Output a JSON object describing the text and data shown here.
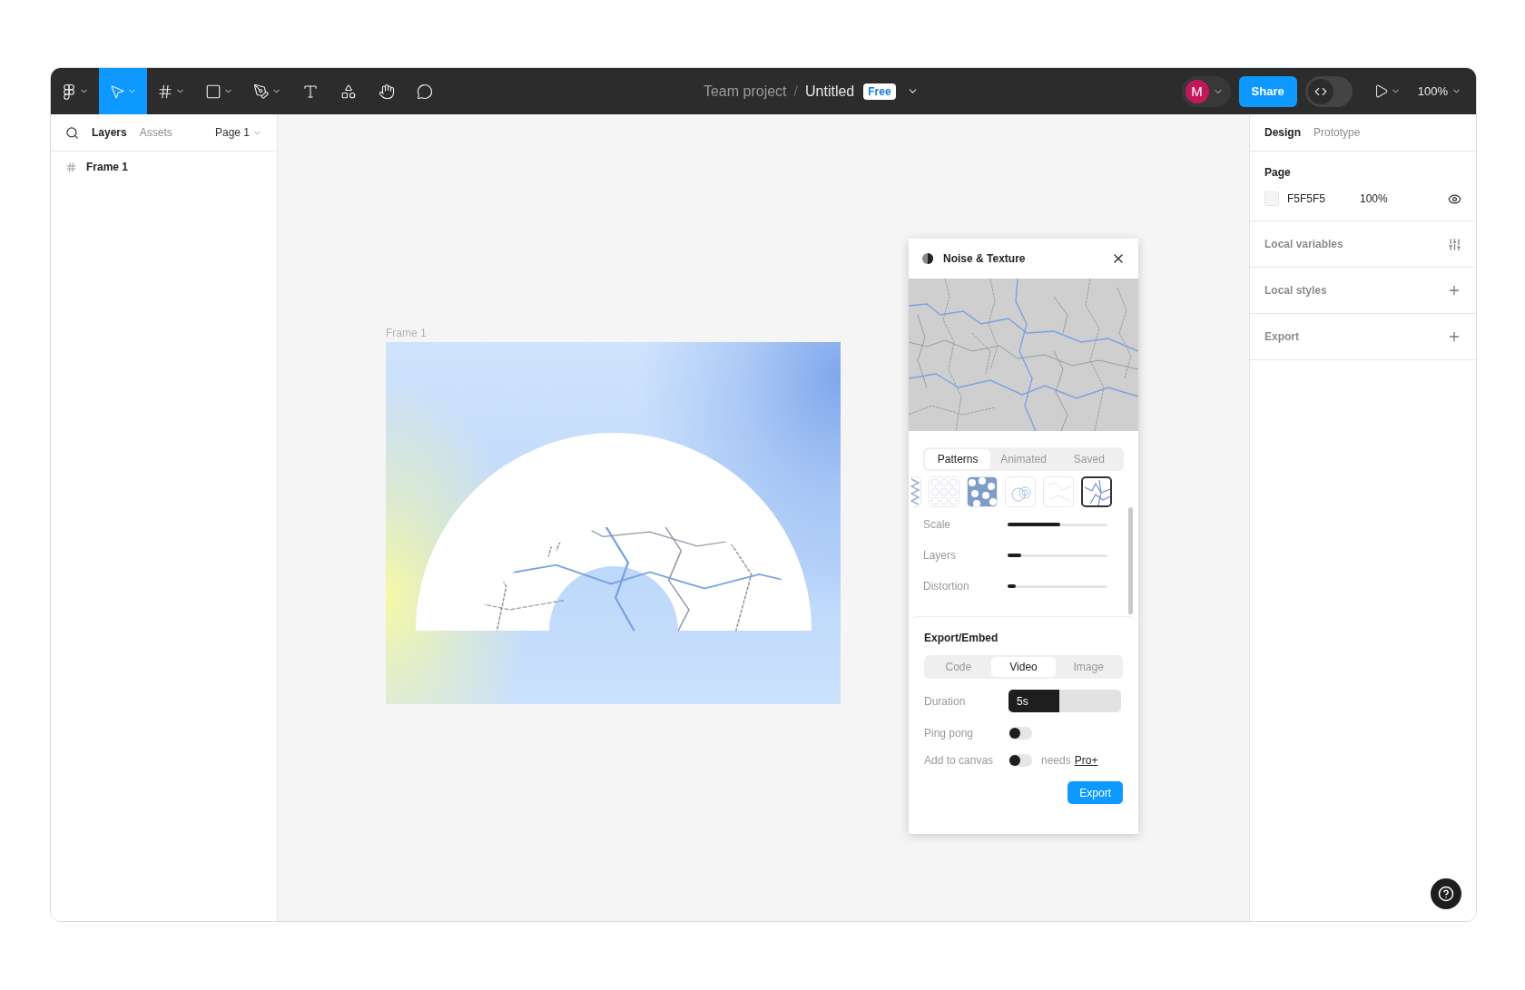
{
  "toolbar": {
    "tools": [
      {
        "kind": "menu",
        "selected": false,
        "caret": true
      },
      {
        "kind": "move",
        "selected": true,
        "caret": true
      },
      {
        "kind": "frame",
        "selected": false,
        "caret": true
      },
      {
        "kind": "shape",
        "selected": false,
        "caret": true
      },
      {
        "kind": "pen",
        "selected": false,
        "caret": true
      },
      {
        "kind": "text",
        "selected": false,
        "caret": false
      },
      {
        "kind": "components",
        "selected": false,
        "caret": false
      },
      {
        "kind": "hand",
        "selected": false,
        "caret": false
      },
      {
        "kind": "comment",
        "selected": false,
        "caret": false
      }
    ],
    "project": "Team project",
    "separator": "/",
    "file": "Untitled",
    "plan_badge": "Free",
    "avatar": "M",
    "share": "Share",
    "dev_mode": {
      "on": false
    },
    "zoom": "100%"
  },
  "left_panel": {
    "tabs": [
      {
        "label": "Layers",
        "selected": true
      },
      {
        "label": "Assets",
        "selected": false
      }
    ],
    "page": "Page 1",
    "layers": [
      {
        "name": "Frame 1"
      }
    ]
  },
  "canvas": {
    "frame_label": "Frame 1"
  },
  "plugin": {
    "title": "Noise & Texture",
    "tabs": [
      {
        "label": "Patterns",
        "selected": true
      },
      {
        "label": "Animated",
        "selected": false
      },
      {
        "label": "Saved",
        "selected": false
      }
    ],
    "patterns": [
      {
        "kind": "zigzag",
        "selected": false
      },
      {
        "kind": "cells",
        "selected": false
      },
      {
        "kind": "blobs",
        "selected": false
      },
      {
        "kind": "rings",
        "selected": false
      },
      {
        "kind": "faint",
        "selected": false
      },
      {
        "kind": "cracks",
        "selected": true
      }
    ],
    "sliders": [
      {
        "label": "Scale",
        "level": 0.53
      },
      {
        "label": "Layers",
        "level": 0.14
      },
      {
        "label": "Distortion",
        "level": 0.08
      }
    ],
    "export_title": "Export/Embed",
    "export_tabs": [
      {
        "label": "Code",
        "selected": false
      },
      {
        "label": "Video",
        "selected": true
      },
      {
        "label": "Image",
        "selected": false
      }
    ],
    "duration": {
      "label": "Duration",
      "value": "5s",
      "level": 0.45
    },
    "toggles": [
      {
        "label": "Ping pong",
        "on": false
      },
      {
        "label": "Add to canvas",
        "on": false,
        "note": "needs",
        "link": "Pro+"
      }
    ],
    "button": "Export"
  },
  "right_panel": {
    "tabs": [
      {
        "label": "Design",
        "selected": true
      },
      {
        "label": "Prototype",
        "selected": false
      }
    ],
    "page": {
      "title": "Page",
      "color": "F5F5F5",
      "opacity": "100%"
    },
    "sections": [
      {
        "title": "Local variables",
        "kind": "variables"
      },
      {
        "title": "Local styles",
        "kind": "add"
      },
      {
        "title": "Export",
        "kind": "add"
      }
    ]
  }
}
